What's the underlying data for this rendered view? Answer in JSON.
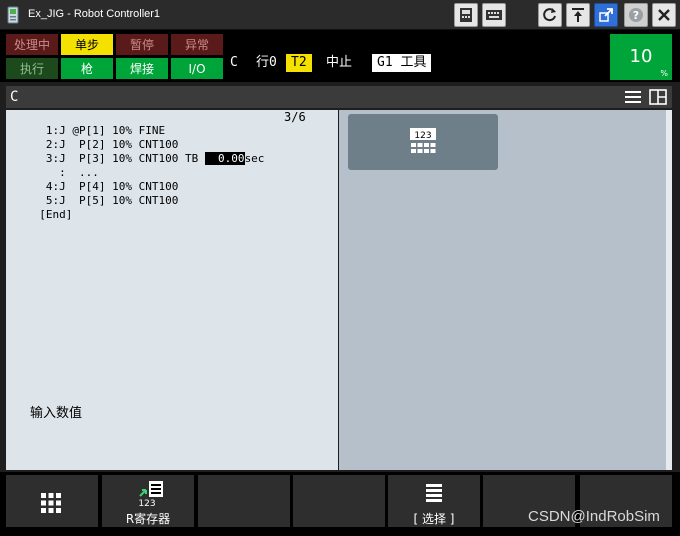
{
  "window": {
    "title": "Ex_JIG - Robot Controller1",
    "toolbar_icons": [
      "tp-icon",
      "keyboard-icon",
      "reset-icon",
      "restore-icon",
      "external-icon",
      "help-icon",
      "close-icon"
    ]
  },
  "status": {
    "lamps_row1": [
      {
        "label": "处理中",
        "state": "off",
        "color": "#5a1a1a"
      },
      {
        "label": "单步",
        "state": "on",
        "color": "#f5e100"
      },
      {
        "label": "暂停",
        "state": "off",
        "color": "#5a1a1a"
      },
      {
        "label": "异常",
        "state": "off",
        "color": "#5a1a1a"
      }
    ],
    "lamps_row2": [
      {
        "label": "执行",
        "state": "off",
        "color": "#1d4a1d"
      },
      {
        "label": "枪",
        "state": "on",
        "color": "#00a53a"
      },
      {
        "label": "焊接",
        "state": "on",
        "color": "#00a53a"
      },
      {
        "label": "I/O",
        "state": "on",
        "color": "#00a53a"
      }
    ],
    "program": "C",
    "line": "行0",
    "mode": "T2",
    "state": "中止",
    "group": "G1 工具",
    "override": "10",
    "override_unit": "%"
  },
  "editor": {
    "header_title": "C",
    "page_indicator": "3/6",
    "lines": [
      "   1:J @P[1] 10% FINE",
      "   2:J  P[2] 10% CNT100",
      "   3:J  P[3] 10% CNT100 TB ",
      "     :  ...",
      "   4:J  P[4] 10% CNT100",
      "   5:J  P[5] 10% CNT100",
      "  [End]"
    ],
    "tb_value": "  0.00",
    "tb_unit": "sec",
    "prompt": "输入数值"
  },
  "right_panel": {
    "numpad_label": "123"
  },
  "function_keys": [
    {
      "label": "",
      "icon": "grid-menu-icon"
    },
    {
      "label": "R寄存器",
      "icon": "register-icon",
      "icon_text": "123"
    },
    {
      "label": "",
      "icon": ""
    },
    {
      "label": "",
      "icon": ""
    },
    {
      "label": "[ 选择 ]",
      "icon": "list-icon"
    },
    {
      "label": "",
      "icon": ""
    },
    {
      "label": "",
      "icon": ""
    }
  ],
  "watermark": "CSDN@IndRobSim",
  "colors": {
    "lamp_yellow": "#f5e100",
    "lamp_green": "#00a53a",
    "left_pane_bg": "#dde4ea",
    "right_pane_bg": "#b5c0ca"
  }
}
